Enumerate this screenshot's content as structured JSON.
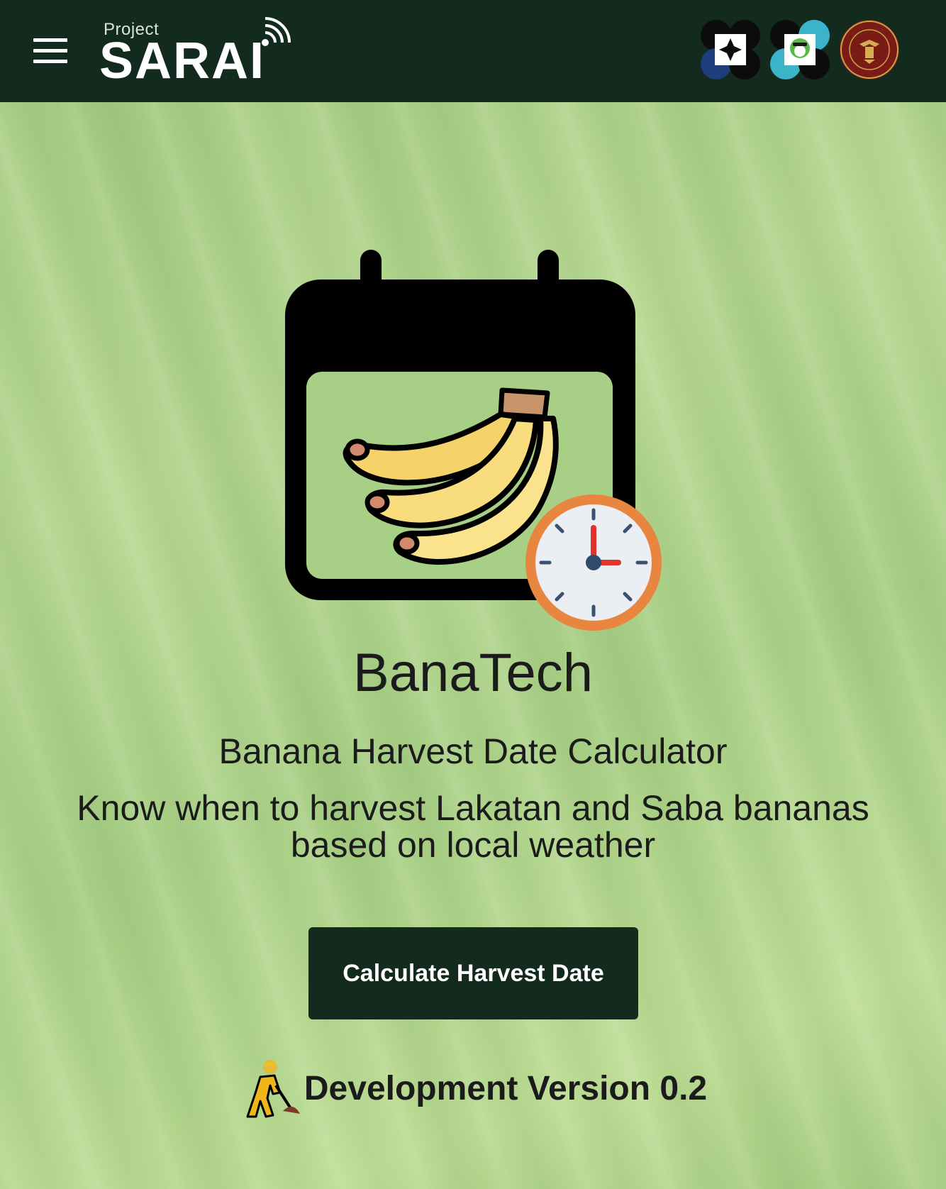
{
  "header": {
    "brand_small": "Project",
    "brand_name": "SARAI",
    "menu_icon": "hamburger-menu-icon",
    "partner_logos": [
      "dost-logo",
      "pcaarrd-logo",
      "up-seal-logo"
    ]
  },
  "main": {
    "hero_icon": "banana-calendar-clock-icon",
    "app_title": "BanaTech",
    "subtitle": "Banana Harvest Date Calculator",
    "description": "Know when to harvest Lakatan and Saba bananas based on local weather",
    "cta_label": "Calculate Harvest Date",
    "version_icon": "construction-worker-icon",
    "version_text": "Development Version 0.2"
  },
  "colors": {
    "header_bg": "#132a1f",
    "button_bg": "#132a1f",
    "page_bg": "#a9cf86",
    "text": "#1b1b1b"
  }
}
